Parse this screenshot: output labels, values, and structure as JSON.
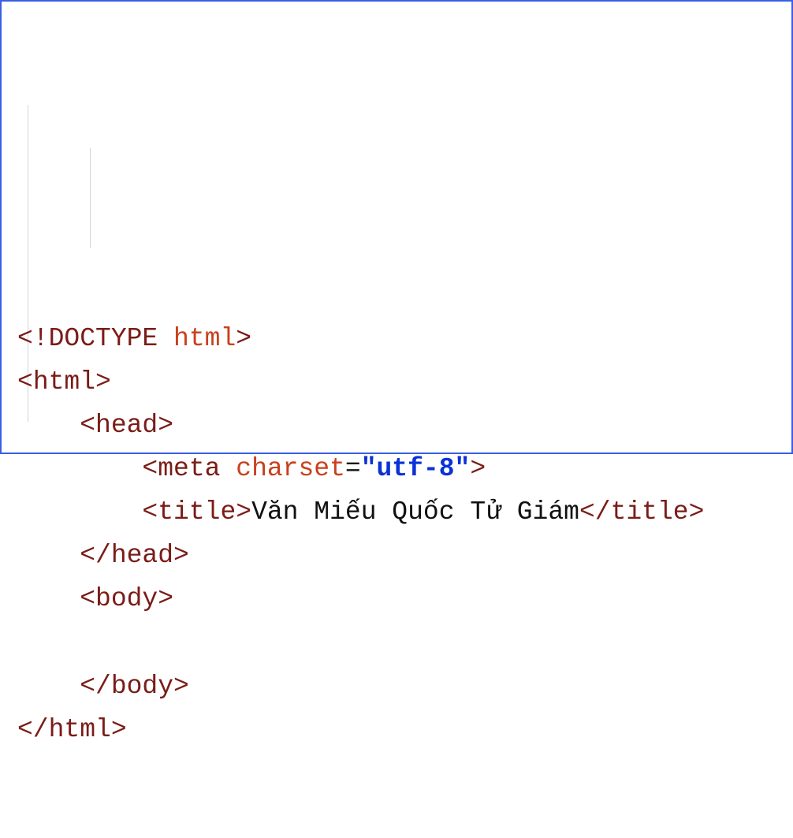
{
  "code": {
    "line1": {
      "open": "<!",
      "doctype": "DOCTYPE",
      "space": " ",
      "html": "html",
      "close": ">"
    },
    "line2": {
      "open": "<",
      "tag": "html",
      "close": ">"
    },
    "line3": {
      "open": "<",
      "tag": "head",
      "close": ">"
    },
    "line4": {
      "open": "<",
      "tag": "meta",
      "space": " ",
      "attr": "charset",
      "eq": "=",
      "val": "\"utf-8\"",
      "close": ">"
    },
    "line5": {
      "open": "<",
      "tag": "title",
      "close1": ">",
      "text": "Văn Miếu Quốc Tử Giám",
      "open2": "</",
      "tag2": "title",
      "close2": ">"
    },
    "line6": {
      "open": "</",
      "tag": "head",
      "close": ">"
    },
    "line7": {
      "open": "<",
      "tag": "body",
      "close": ">"
    },
    "line8": {
      "blank": " "
    },
    "line9": {
      "open": "</",
      "tag": "body",
      "close": ">"
    },
    "line10": {
      "open": "</",
      "tag": "html",
      "close": ">"
    }
  }
}
